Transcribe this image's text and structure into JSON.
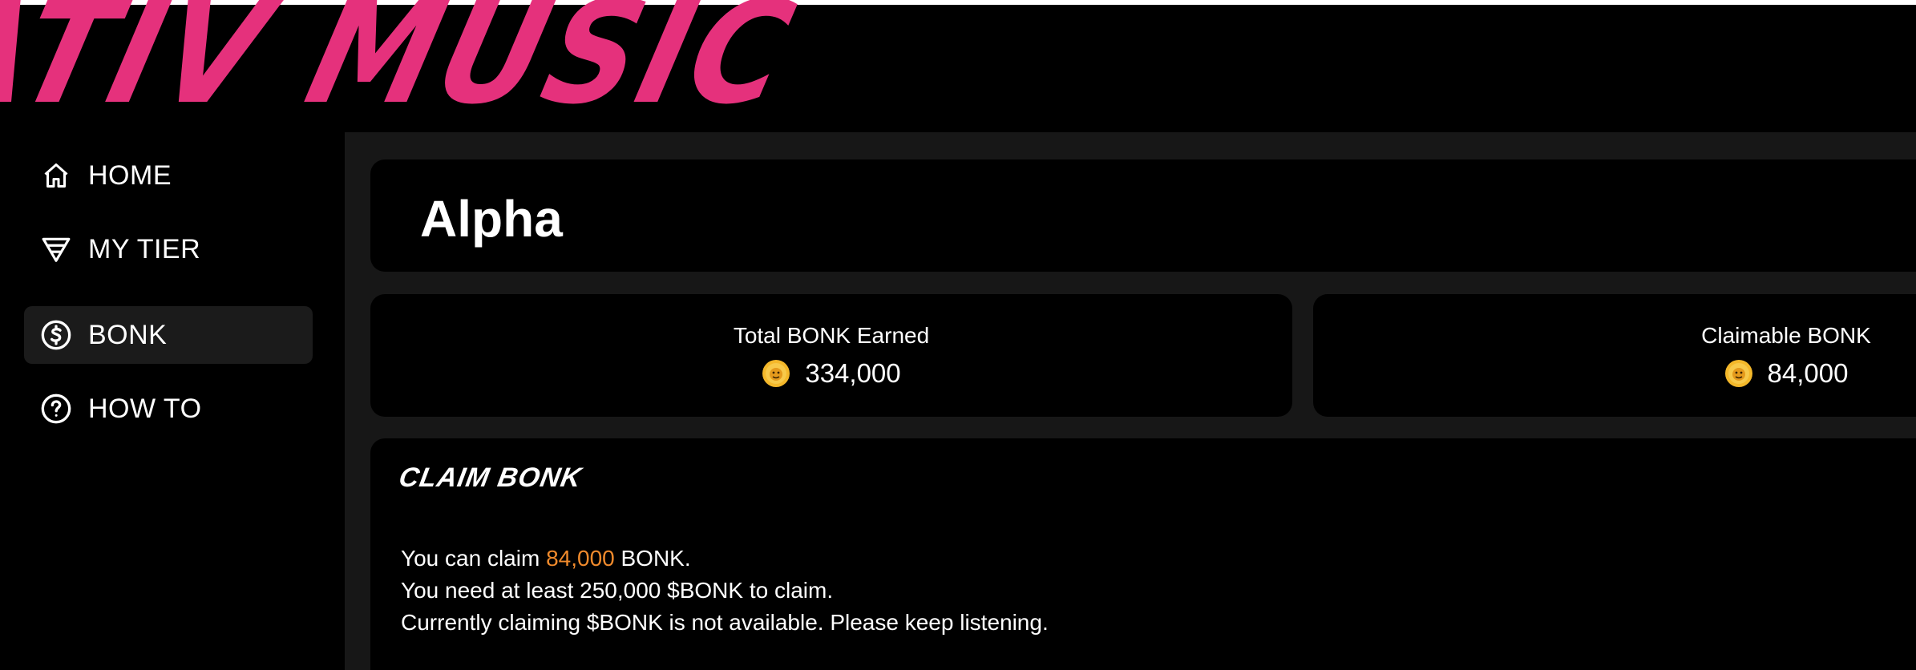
{
  "logo": {
    "text": "ATIV MUSIC",
    "color": "#e5317c"
  },
  "sidebar": {
    "items": [
      {
        "label": "HOME",
        "icon": "home-icon",
        "active": false
      },
      {
        "label": "MY TIER",
        "icon": "tier-icon",
        "active": false
      },
      {
        "label": "BONK",
        "icon": "dollar-circle-icon",
        "active": true
      },
      {
        "label": "HOW TO",
        "icon": "question-circle-icon",
        "active": false
      }
    ]
  },
  "main": {
    "title": "Alpha",
    "stats": [
      {
        "label": "Total BONK Earned",
        "value": "334,000",
        "icon": "bonk-coin-icon"
      },
      {
        "label": "Claimable BONK",
        "value": "84,000",
        "icon": "bonk-coin-icon"
      }
    ],
    "claim": {
      "heading": "CLAIM BONK",
      "line1_prefix": "You can claim ",
      "line1_amount": "84,000",
      "line1_suffix": " BONK.",
      "line2": "You need at least 250,000 $BONK to claim.",
      "line3": "Currently claiming $BONK is not available. Please keep listening."
    }
  },
  "colors": {
    "background": "#000000",
    "panel": "#171717",
    "active_nav": "#1b1b1b",
    "accent_amount": "#f08a2c",
    "brand": "#e5317c"
  }
}
